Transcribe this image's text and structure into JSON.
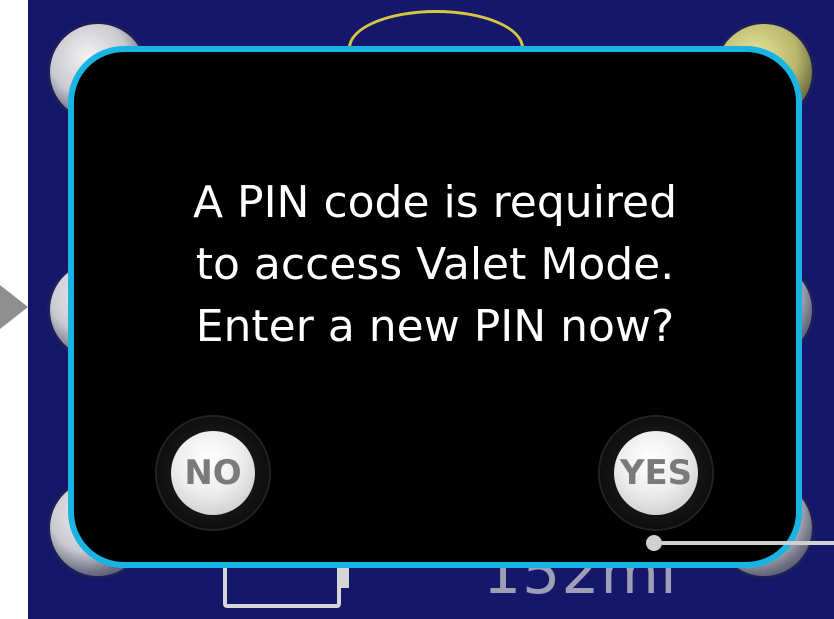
{
  "dialog": {
    "message_lines": [
      "A PIN code is required",
      "to access Valet Mode.",
      "Enter a new PIN now?"
    ],
    "no_label": "NO",
    "yes_label": "YES"
  },
  "background": {
    "range": "152mi"
  },
  "colors": {
    "screen_bg": "#14176a",
    "dialog_border": "#18b4e4",
    "dialog_bg": "#000000"
  }
}
